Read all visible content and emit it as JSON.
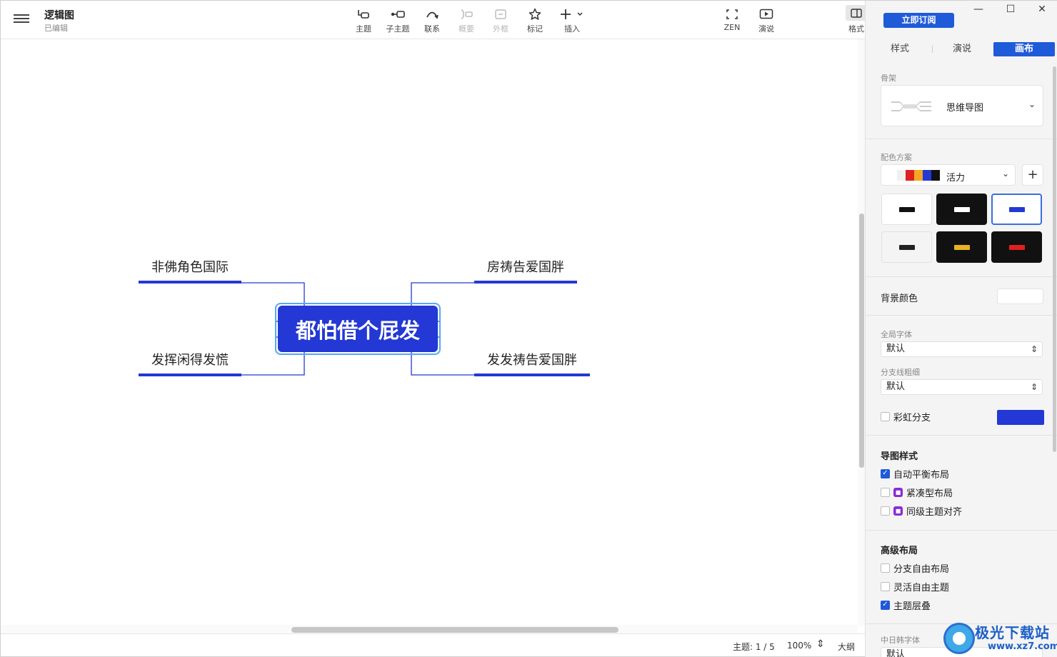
{
  "doc": {
    "title": "逻辑图",
    "status": "已编辑"
  },
  "toolbar": {
    "topic": "主题",
    "subtopic": "子主题",
    "relation": "联系",
    "summary": "概要",
    "boundary": "外框",
    "marker": "标记",
    "insert": "插入",
    "zen": "ZEN",
    "present": "演说",
    "format": "格式"
  },
  "mindmap": {
    "central": "都怕借个屁发",
    "left_topics": [
      "非佛角色国际",
      "发挥闲得发慌"
    ],
    "right_topics": [
      "房祷告爱国胖",
      "发发祷告爱国胖"
    ],
    "accent_color": "#2338d4"
  },
  "status_bar": {
    "topic_count": "主题: 1 / 5",
    "zoom": "100%",
    "outline": "大纲"
  },
  "panel": {
    "subscribe_label": "立即订阅",
    "tabs": [
      "样式",
      "演说",
      "画布"
    ],
    "active_tab": "画布",
    "skeleton": {
      "label": "骨架",
      "value": "思维导图"
    },
    "color_scheme": {
      "label": "配色方案",
      "value": "活力",
      "swatches": [
        "#f0f0f0",
        "#e02020",
        "#f5a623",
        "#2338d4",
        "#111111"
      ]
    },
    "bg_color_label": "背景颜色",
    "global_font": {
      "label": "全局字体",
      "value": "默认"
    },
    "branch_width": {
      "label": "分支线粗细",
      "value": "默认"
    },
    "rainbow_branch": {
      "label": "彩虹分支",
      "checked": false,
      "color": "#2338d4"
    },
    "map_style": {
      "heading": "导图样式",
      "options": [
        {
          "label": "自动平衡布局",
          "checked": true,
          "locked": false
        },
        {
          "label": "紧凑型布局",
          "checked": false,
          "locked": true
        },
        {
          "label": "同级主题对齐",
          "checked": false,
          "locked": true
        }
      ]
    },
    "advanced_layout": {
      "heading": "高级布局",
      "options": [
        {
          "label": "分支自由布局",
          "checked": false
        },
        {
          "label": "灵活自由主题",
          "checked": false
        },
        {
          "label": "主题层叠",
          "checked": true
        }
      ]
    },
    "cjk_font": {
      "label": "中日韩字体",
      "value": "默认"
    }
  },
  "watermark": {
    "name": "极光下载站",
    "url": "www.xz7.com"
  }
}
